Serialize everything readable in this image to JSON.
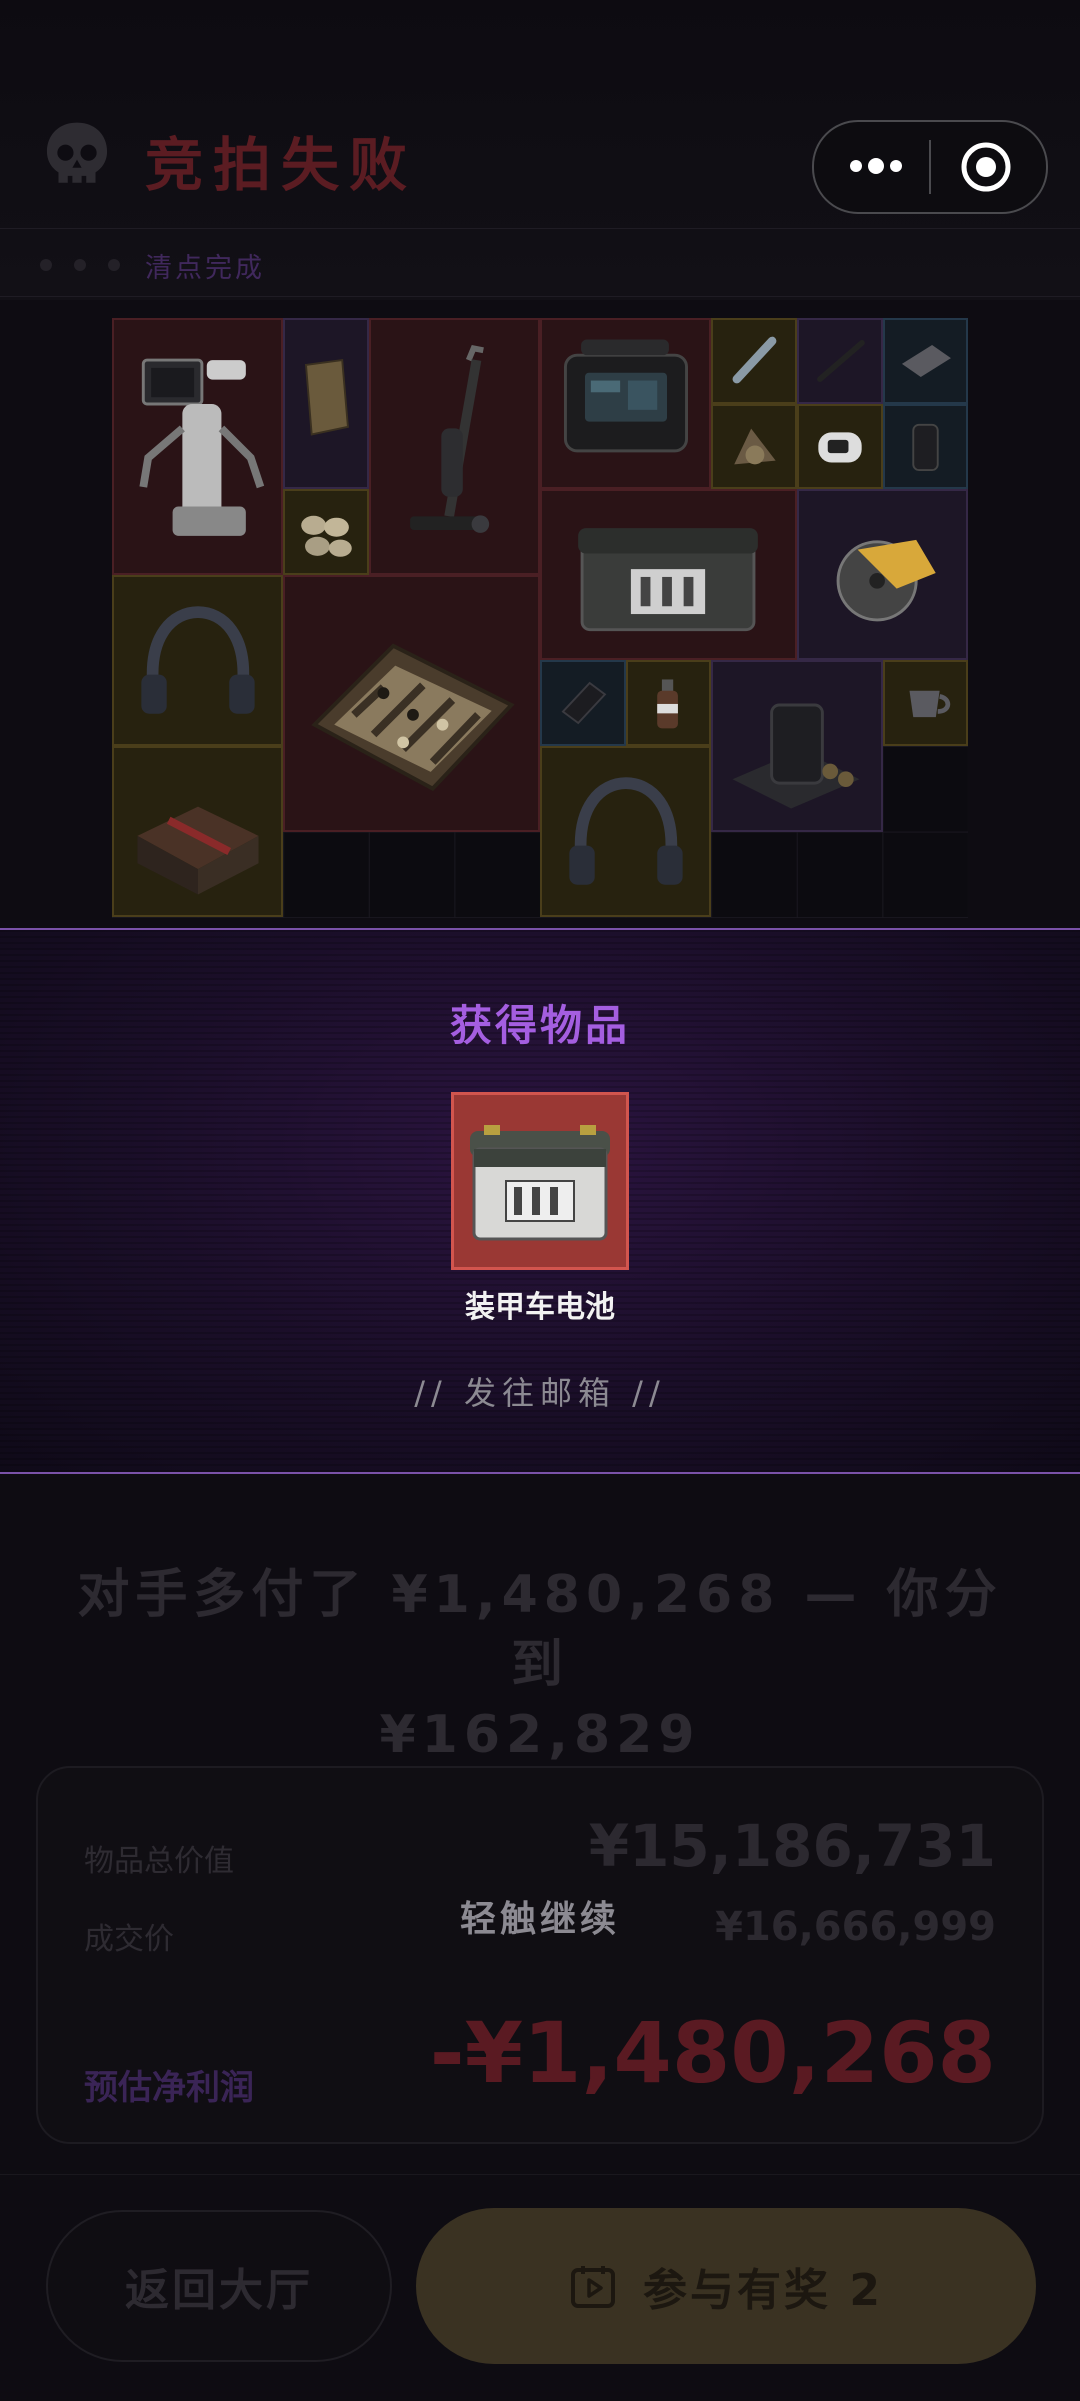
{
  "header": {
    "title": "竞拍失败",
    "status": "清点完成",
    "skull_icon": "skull-icon",
    "capsule": {
      "more_icon": "more-dots-icon",
      "close_icon": "target-circle-icon"
    }
  },
  "grid": {
    "items": [
      {
        "name": "robot",
        "rarity": "red"
      },
      {
        "name": "map-scroll",
        "rarity": "purple"
      },
      {
        "name": "vacuum-cleaner",
        "rarity": "red"
      },
      {
        "name": "power-station",
        "rarity": "red"
      },
      {
        "name": "tube",
        "rarity": "yellow"
      },
      {
        "name": "pen",
        "rarity": "purple"
      },
      {
        "name": "tablet-slab",
        "rarity": "blue"
      },
      {
        "name": "nuts",
        "rarity": "yellow"
      },
      {
        "name": "rubble",
        "rarity": "yellow"
      },
      {
        "name": "oximeter",
        "rarity": "yellow"
      },
      {
        "name": "drink-can",
        "rarity": "blue"
      },
      {
        "name": "ammo-box",
        "rarity": "red"
      },
      {
        "name": "headset",
        "rarity": "yellow"
      },
      {
        "name": "chessboard",
        "rarity": "red"
      },
      {
        "name": "circular-saw",
        "rarity": "purple"
      },
      {
        "name": "phone",
        "rarity": "blue"
      },
      {
        "name": "bottle",
        "rarity": "yellow"
      },
      {
        "name": "coffee-machine",
        "rarity": "purple"
      },
      {
        "name": "cup",
        "rarity": "yellow"
      },
      {
        "name": "supply-crate",
        "rarity": "yellow"
      },
      {
        "name": "headset",
        "rarity": "yellow"
      }
    ]
  },
  "reward": {
    "title": "获得物品",
    "item_name": "装甲车电池",
    "note": "// 发往邮箱 //"
  },
  "summary": {
    "line1": "对手多付了 ¥1,480,268 — 你分到",
    "line2": "¥162,829"
  },
  "card": {
    "total_label": "物品总价值",
    "total_value": "¥15,186,731",
    "deal_label": "成交价",
    "deal_value": "¥16,666,999",
    "tap_text": "轻触继续",
    "profit_label": "预估净利润",
    "profit_value": "-¥1,480,268"
  },
  "buttons": {
    "lobby": "返回大厅",
    "reward": "参与有奖 2",
    "reward_icon": "calendar-play-icon"
  },
  "colors": {
    "bg": "#0e0c12",
    "accent_purple": "#a45ee0",
    "loss_red": "#5a1a22",
    "reward_bg": "#9a3834"
  }
}
